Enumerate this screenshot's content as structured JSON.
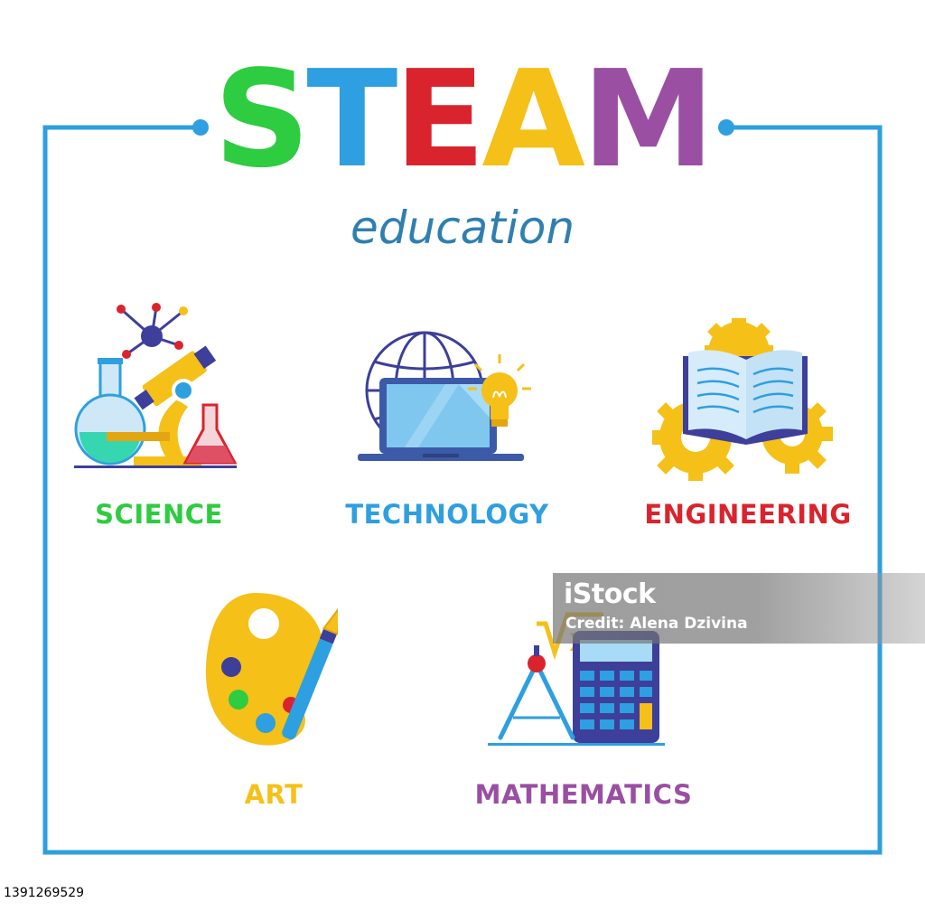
{
  "title": {
    "letters": [
      {
        "char": "S",
        "color": "#2ecc40"
      },
      {
        "char": "T",
        "color": "#2e9fe0"
      },
      {
        "char": "E",
        "color": "#d9242e"
      },
      {
        "char": "A",
        "color": "#f5c018"
      },
      {
        "char": "M",
        "color": "#9a4fa3"
      }
    ]
  },
  "subtitle": "education",
  "frame_color": "#2e9fe0",
  "subjects": [
    {
      "label": "SCIENCE",
      "color": "#2ecc40",
      "icon": "science-icon"
    },
    {
      "label": "TECHNOLOGY",
      "color": "#2e9fe0",
      "icon": "technology-icon"
    },
    {
      "label": "ENGINEERING",
      "color": "#d9242e",
      "icon": "engineering-icon"
    },
    {
      "label": "ART",
      "color": "#f5c018",
      "icon": "art-icon"
    },
    {
      "label": "MATHEMATICS",
      "color": "#9a4fa3",
      "icon": "mathematics-icon"
    }
  ],
  "watermark": {
    "logo": "iStock",
    "credit": "Credit: Alena Dzivina"
  },
  "stock_id": "1391269529"
}
